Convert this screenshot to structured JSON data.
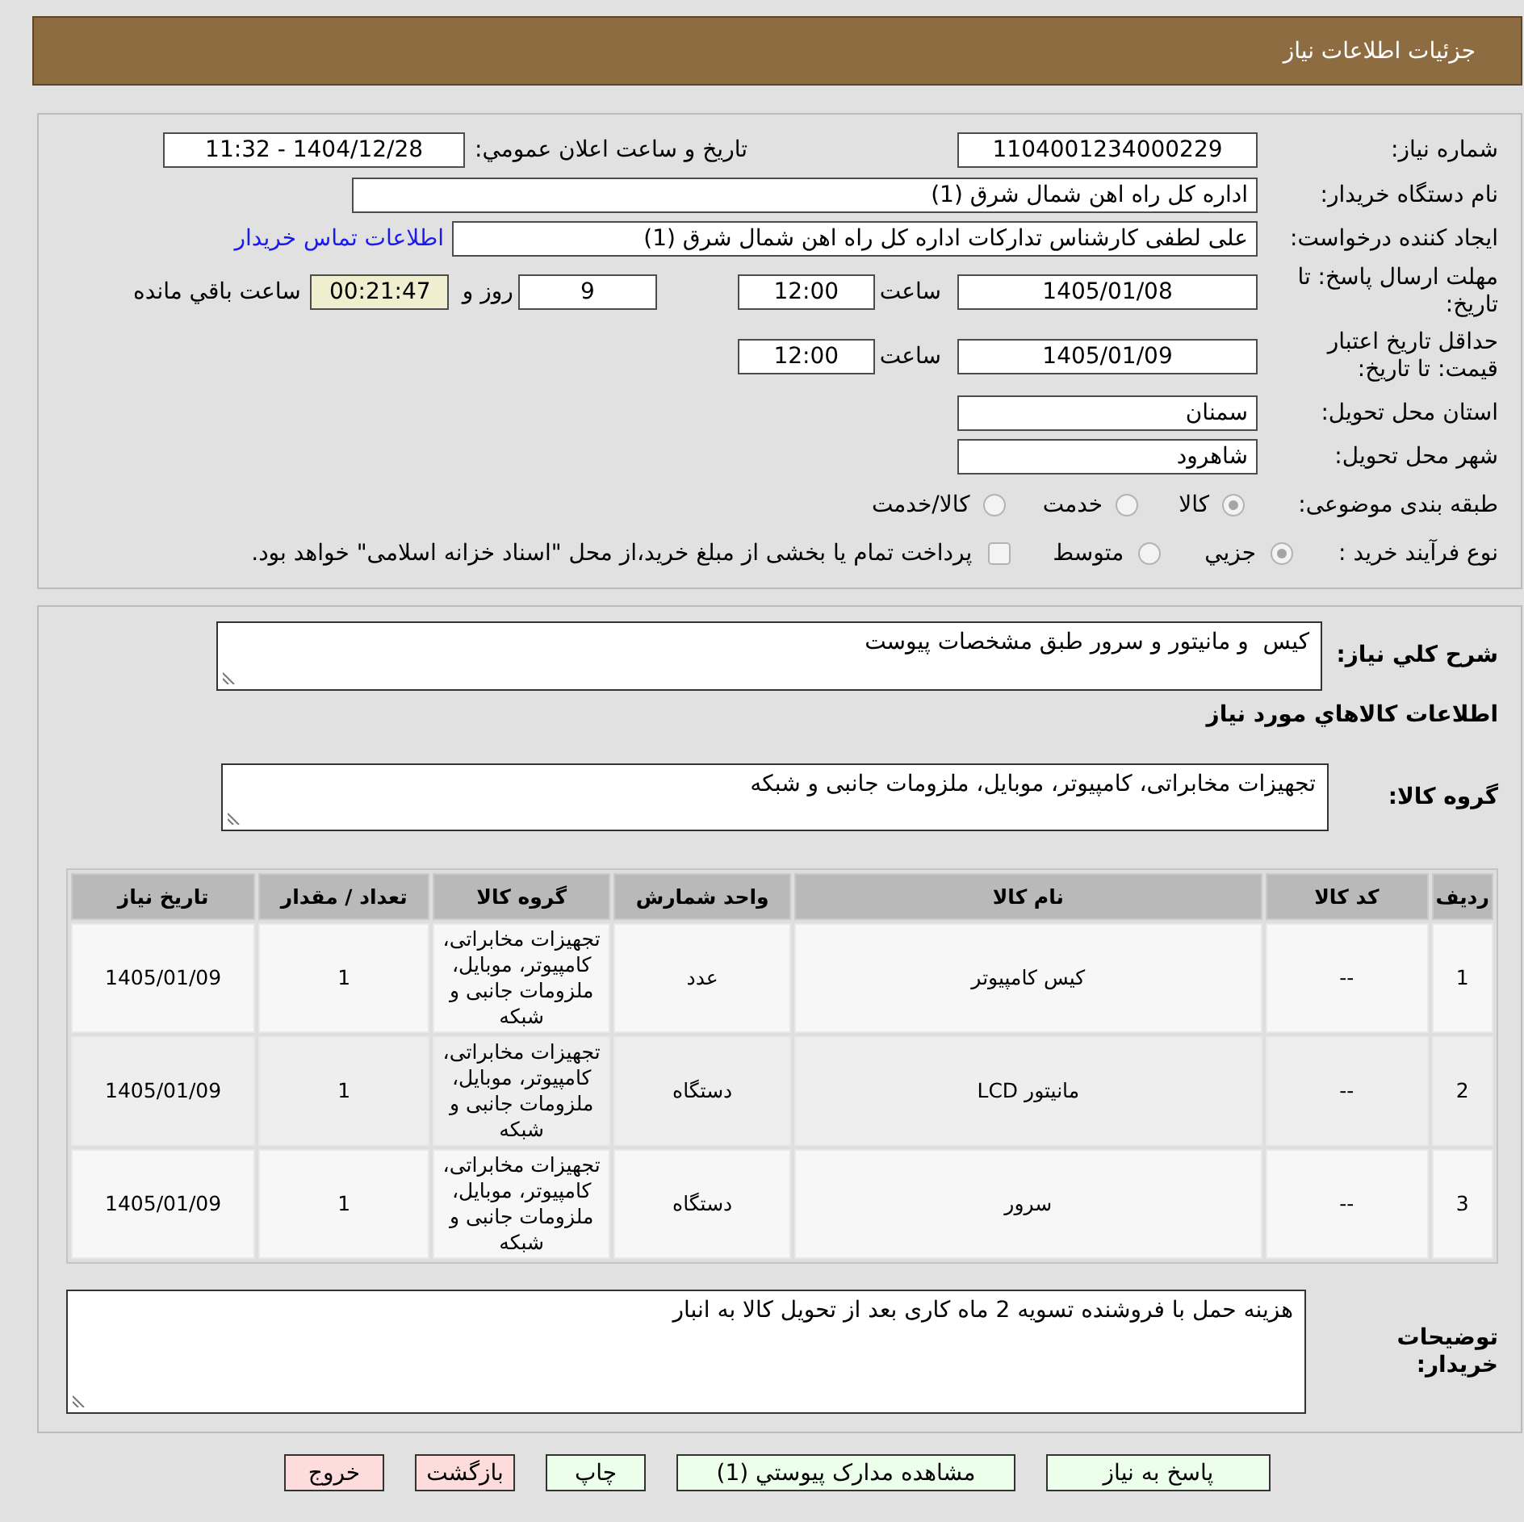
{
  "header": {
    "title": "جزئیات اطلاعات نیاز"
  },
  "details": {
    "need_number": {
      "label": "شماره نیاز:",
      "value": "1104001234000229"
    },
    "announce_datetime": {
      "label": "تاريخ و ساعت اعلان عمومي:",
      "value": "1404/12/28 - 11:32"
    },
    "buyer_org": {
      "label": "نام دستگاه خریدار:",
      "value": "اداره کل راه اهن شمال شرق (1)"
    },
    "requester": {
      "label": "ایجاد کننده درخواست:",
      "value": "علی لطفی کارشناس تدارکات اداره کل راه اهن شمال شرق (1)",
      "link": "اطلاعات تماس خریدار"
    },
    "reply_deadline": {
      "label": "مهلت ارسال پاسخ: تا تاریخ:",
      "date": "1405/01/08",
      "time_label": "ساعت",
      "time": "12:00",
      "days": "9",
      "days_label": "روز و",
      "remaining": "00:21:47",
      "remaining_label": "ساعت باقي مانده"
    },
    "price_validity": {
      "label": "حداقل تاریخ اعتبار قیمت: تا تاریخ:",
      "date": "1405/01/09",
      "time_label": "ساعت",
      "time": "12:00"
    },
    "province": {
      "label": "استان محل تحویل:",
      "value": "سمنان"
    },
    "city": {
      "label": "شهر محل تحویل:",
      "value": "شاهرود"
    },
    "category": {
      "label": "طبقه بندی موضوعی:",
      "options": [
        {
          "label": "کالا",
          "selected": true
        },
        {
          "label": "خدمت",
          "selected": false
        },
        {
          "label": "کالا/خدمت",
          "selected": false
        }
      ]
    },
    "purchase_process": {
      "label": "نوع فرآیند خرید :",
      "options": [
        {
          "label": "جزيي",
          "selected": true
        },
        {
          "label": "متوسط",
          "selected": false
        }
      ],
      "treasury_payment": {
        "label": "پرداخت تمام یا بخشی از مبلغ خرید،از محل \"اسناد خزانه اسلامی\" خواهد بود.",
        "checked": false
      }
    }
  },
  "need_summary": {
    "label": "شرح کلي نیاز:",
    "value": "کیس  و مانیتور و سرور طبق مشخصات پیوست"
  },
  "goods_section": {
    "title": "اطلاعات کالاهاي مورد نیاز",
    "group": {
      "label": "گروه کالا:",
      "value": "تجهیزات مخابراتی، کامپیوتر، موبایل، ملزومات جانبی و شبکه"
    }
  },
  "table": {
    "columns": [
      "ردیف",
      "کد کالا",
      "نام کالا",
      "واحد شمارش",
      "گروه کالا",
      "تعداد / مقدار",
      "تاريخ نیاز"
    ],
    "rows": [
      [
        "1",
        "--",
        "کیس کامپیوتر",
        "عدد",
        "تجهیزات مخابراتی، کامپیوتر، موبایل، ملزومات جانبی و شبکه",
        "1",
        "1405/01/09"
      ],
      [
        "2",
        "--",
        "مانیتور LCD",
        "دستگاه",
        "تجهیزات مخابراتی، کامپیوتر، موبایل، ملزومات جانبی و شبکه",
        "1",
        "1405/01/09"
      ],
      [
        "3",
        "--",
        "سرور",
        "دستگاه",
        "تجهیزات مخابراتی، کامپیوتر، موبایل، ملزومات جانبی و شبکه",
        "1",
        "1405/01/09"
      ]
    ]
  },
  "buyer_notes": {
    "label": "توضیحات خریدار:",
    "value": "هزینه حمل با فروشنده تسویه 2 ماه کاری بعد از تحویل کالا به انبار"
  },
  "buttons": [
    {
      "label": "پاسخ به نیاز",
      "color": "#ebffeb"
    },
    {
      "label": "مشاهده مدارک پیوستي (1)",
      "color": "#ebffeb"
    },
    {
      "label": "چاپ",
      "color": "#ebffeb"
    },
    {
      "label": "بازگشت",
      "color": "#ffdcdc"
    },
    {
      "label": "خروج",
      "color": "#ffdcdc"
    }
  ]
}
